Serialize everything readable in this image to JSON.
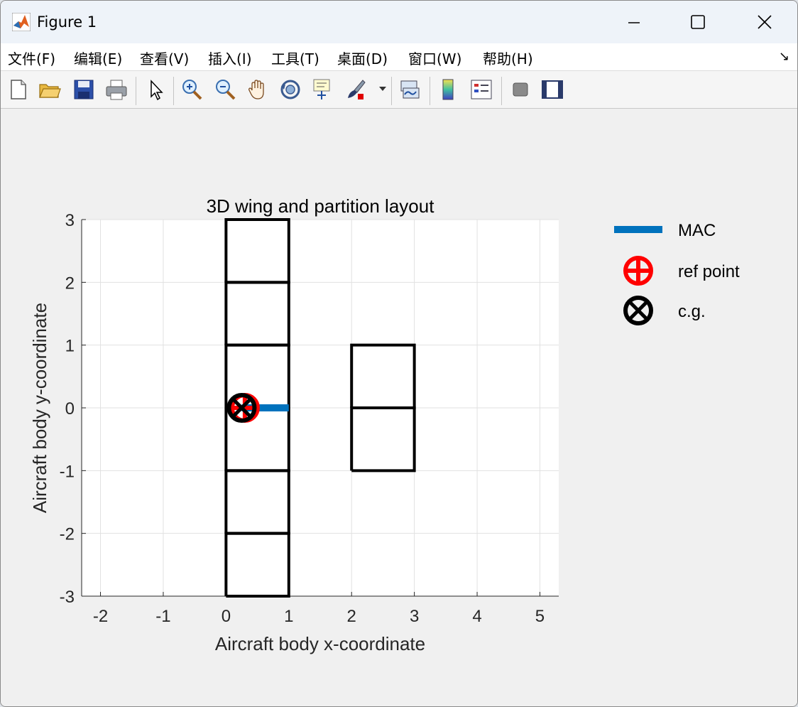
{
  "window": {
    "title": "Figure 1"
  },
  "menu": [
    "文件(F)",
    "编辑(E)",
    "查看(V)",
    "插入(I)",
    "工具(T)",
    "桌面(D)",
    "窗口(W)",
    "帮助(H)"
  ],
  "toolbar": [
    "new-figure-icon",
    "open-file-icon",
    "save-icon",
    "print-icon",
    "select-arrow-icon",
    "zoom-in-icon",
    "zoom-out-icon",
    "pan-hand-icon",
    "rotate-3d-icon",
    "data-cursor-icon",
    "brush-icon",
    "link-plot-icon",
    "colorbar-icon",
    "legend-icon",
    "hide-plot-tools-icon",
    "show-plot-tools-icon"
  ],
  "chart_data": {
    "type": "line",
    "title": "3D wing and partition layout",
    "xlabel": "Aircraft body x-coordinate",
    "ylabel": "Aircraft body y-coordinate",
    "xlim": [
      -2.3,
      5.3
    ],
    "ylim": [
      -3,
      3
    ],
    "xticks": [
      -2,
      -1,
      0,
      1,
      2,
      3,
      4,
      5
    ],
    "yticks": [
      -3,
      -2,
      -1,
      0,
      1,
      2,
      3
    ],
    "grid": true,
    "colors": {
      "mac": "#0072BD",
      "ref": "#FF0000",
      "cg": "#000000",
      "outline": "#000000"
    },
    "wing_partitions": [
      {
        "x": [
          0,
          1,
          1,
          0,
          0
        ],
        "y": [
          2,
          2,
          3,
          3,
          2
        ]
      },
      {
        "x": [
          0,
          1,
          1,
          0,
          0
        ],
        "y": [
          1,
          1,
          2,
          2,
          1
        ]
      },
      {
        "x": [
          0,
          1,
          1,
          0,
          0
        ],
        "y": [
          -1,
          -1,
          1,
          1,
          -1
        ]
      },
      {
        "x": [
          0,
          1,
          1,
          0,
          0
        ],
        "y": [
          -2,
          -2,
          -1,
          -1,
          -2
        ]
      },
      {
        "x": [
          0,
          1,
          1,
          0,
          0
        ],
        "y": [
          -3,
          -3,
          -2,
          -2,
          -3
        ]
      }
    ],
    "tail_partitions": [
      {
        "x": [
          2,
          3,
          3,
          2,
          2
        ],
        "y": [
          0,
          0,
          1,
          1,
          0
        ]
      },
      {
        "x": [
          2,
          3,
          3,
          2,
          2
        ],
        "y": [
          -1,
          -1,
          0,
          0,
          -1
        ]
      }
    ],
    "mac": {
      "x": [
        0.25,
        1
      ],
      "y": [
        0,
        0
      ]
    },
    "ref_point": {
      "x": 0.3,
      "y": 0
    },
    "cg": {
      "x": 0.25,
      "y": 0
    },
    "legend": {
      "placement": "outside-right",
      "entries": [
        {
          "label": "MAC",
          "marker": "line",
          "color": "#0072BD"
        },
        {
          "label": "ref point",
          "marker": "circle-plus",
          "color": "#FF0000"
        },
        {
          "label": "c.g.",
          "marker": "circle-x",
          "color": "#000000"
        }
      ]
    }
  }
}
